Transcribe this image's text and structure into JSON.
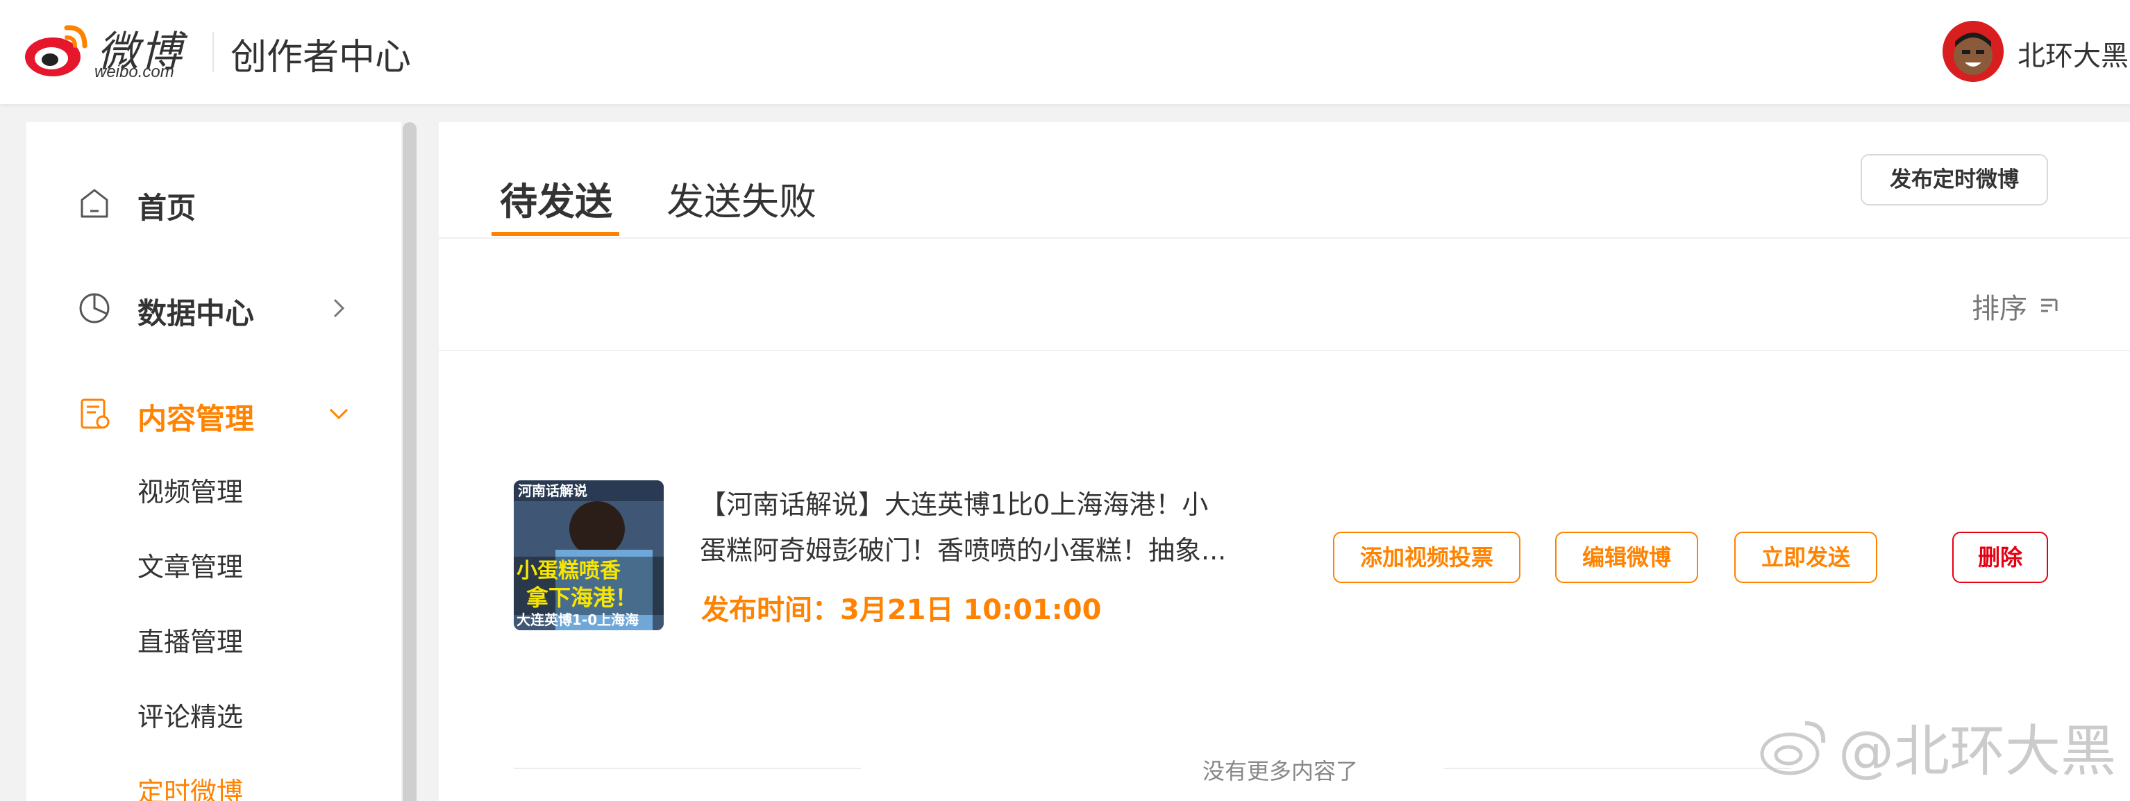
{
  "header": {
    "logo_text": "微博",
    "logo_sub": "weibo.com",
    "title": "创作者中心",
    "username": "北环大黑"
  },
  "sidebar": {
    "items": [
      {
        "label": "首页",
        "icon": "home-icon"
      },
      {
        "label": "数据中心",
        "icon": "pie-chart-icon"
      },
      {
        "label": "内容管理",
        "icon": "document-icon",
        "active": true
      }
    ],
    "sub_items": [
      {
        "label": "视频管理"
      },
      {
        "label": "文章管理"
      },
      {
        "label": "直播管理"
      },
      {
        "label": "评论精选"
      },
      {
        "label": "定时微博",
        "active": true
      }
    ]
  },
  "main": {
    "tabs": [
      {
        "label": "待发送",
        "active": true
      },
      {
        "label": "发送失败"
      }
    ],
    "publish_button": "发布定时微博",
    "sort_label": "排序",
    "post": {
      "thumb_lines": [
        "河南话解说",
        "小蛋糕喷香",
        "拿下海港！",
        "大连英博1-0上海海"
      ],
      "text_line1": "【河南话解说】大连英博1比0上海海港！小",
      "text_line2": "蛋糕阿奇姆彭破门！香喷喷的小蛋糕！抽象...",
      "time": "发布时间：3月21日 10:01:00"
    },
    "actions": {
      "add_vote": "添加视频投票",
      "edit": "编辑微博",
      "send_now": "立即发送",
      "delete": "删除"
    },
    "no_more": "没有更多内容了"
  },
  "watermark": "@北环大黑",
  "colors": {
    "accent": "#ff8200",
    "danger": "#e60012",
    "weibo_red": "#e6162d"
  }
}
